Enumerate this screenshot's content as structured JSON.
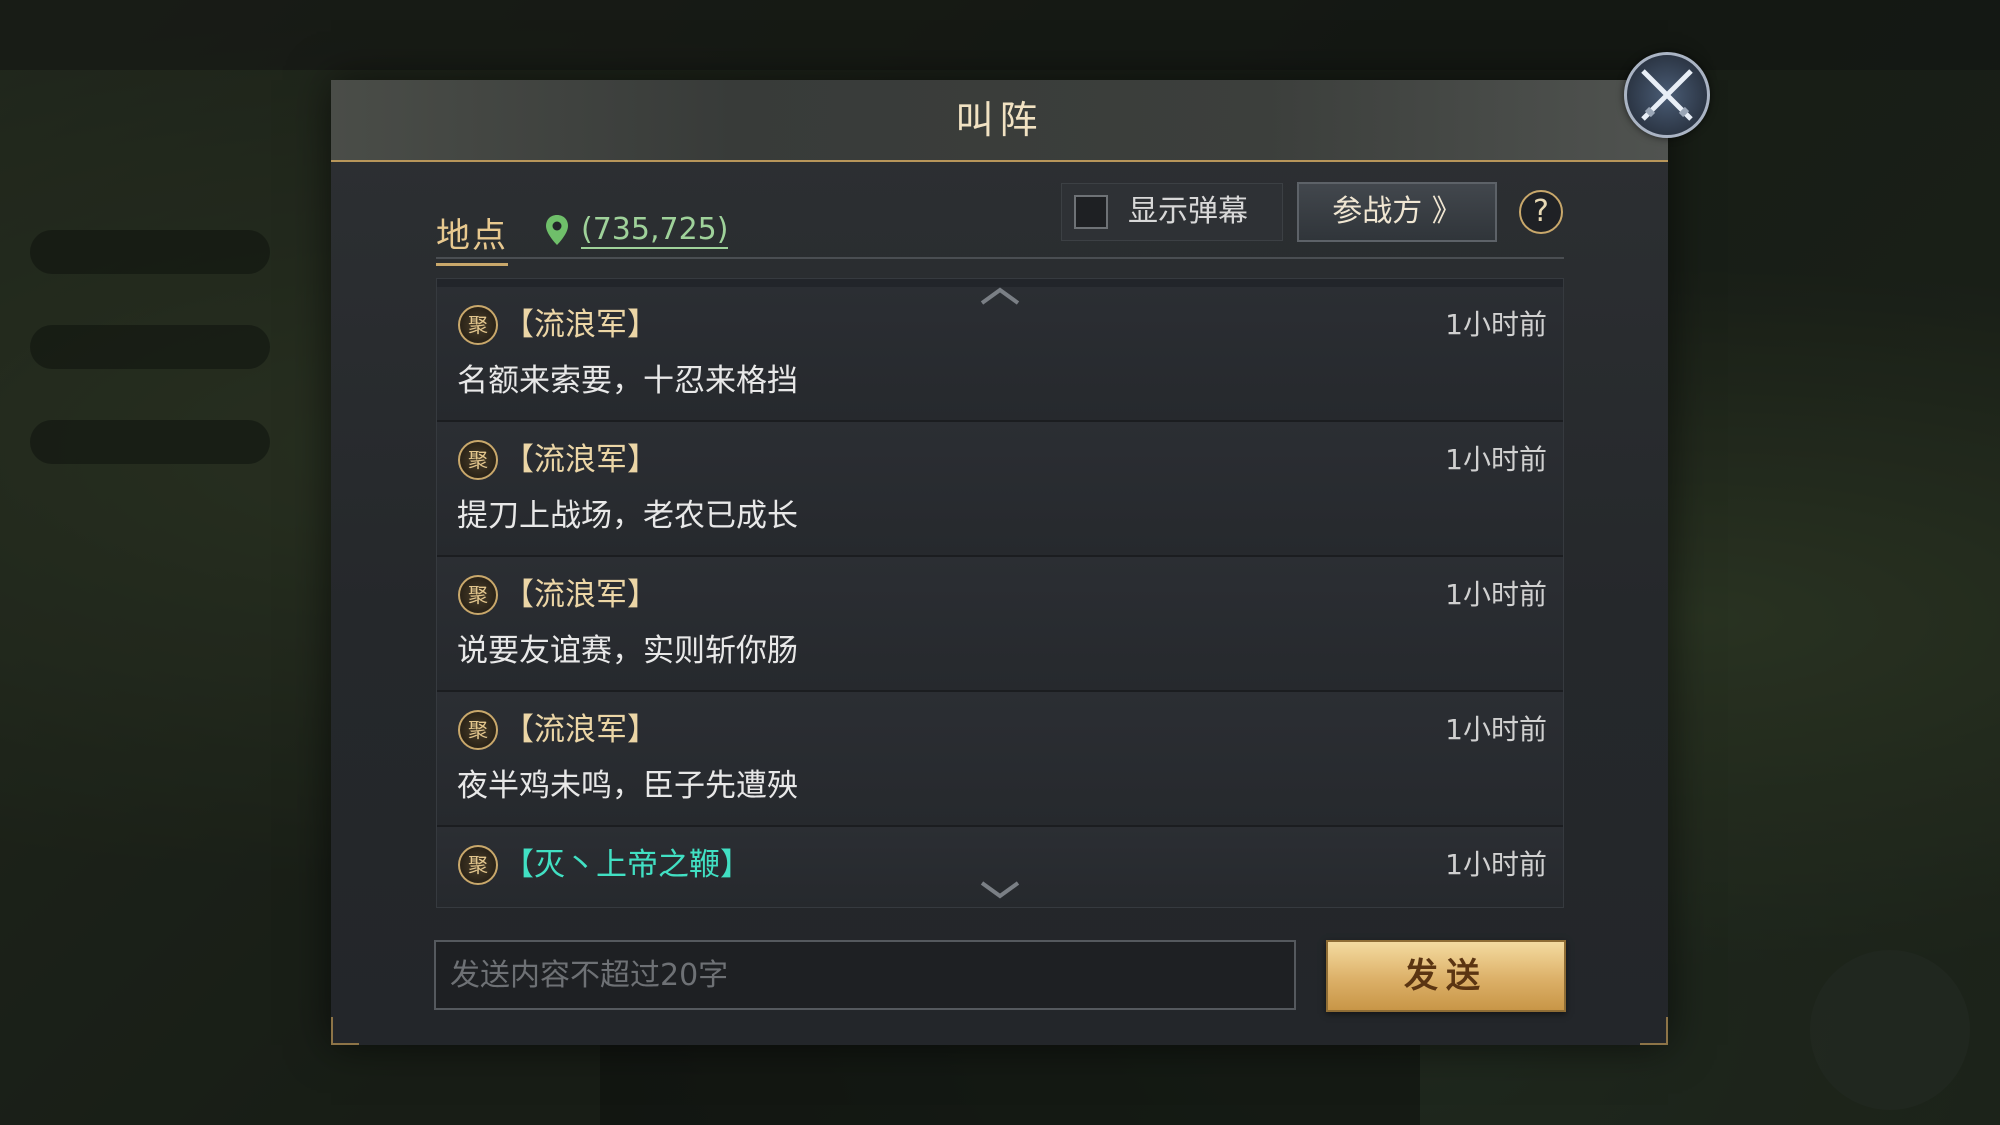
{
  "dialog": {
    "title": "叫阵",
    "location_label": "地点",
    "location_coords": "(735,725)",
    "show_danmaku_label": "显示弹幕",
    "show_danmaku_checked": false,
    "participants_button": "参战方 》",
    "help_label": "?"
  },
  "messages": [
    {
      "sender": "【流浪军】",
      "time": "1小时前",
      "text": "名额来索要，十忍来格挡",
      "badge": "聚"
    },
    {
      "sender": "【流浪军】",
      "time": "1小时前",
      "text": "提刀上战场，老农已成长",
      "badge": "聚"
    },
    {
      "sender": "【流浪军】",
      "time": "1小时前",
      "text": "说要友谊赛，实则斩你肠",
      "badge": "聚"
    },
    {
      "sender": "【流浪军】",
      "time": "1小时前",
      "text": "夜半鸡未鸣，臣子先遭殃",
      "badge": "聚"
    },
    {
      "sender": "【灭丶上帝之鞭】",
      "time": "1小时前",
      "text": "",
      "badge": "聚"
    }
  ],
  "input": {
    "placeholder": "发送内容不超过20字",
    "value": ""
  },
  "send_button": "发送",
  "colors": {
    "accent_gold": "#c9a86b",
    "coords_green": "#9fd29a",
    "guild_teal": "#41e0c3",
    "send_button": "#dcb068"
  },
  "icons": {
    "close": "crossed-swords-icon",
    "location": "location-pin-icon",
    "scroll_up": "chevron-up-icon",
    "scroll_down": "chevron-down-icon",
    "help": "question-icon"
  }
}
